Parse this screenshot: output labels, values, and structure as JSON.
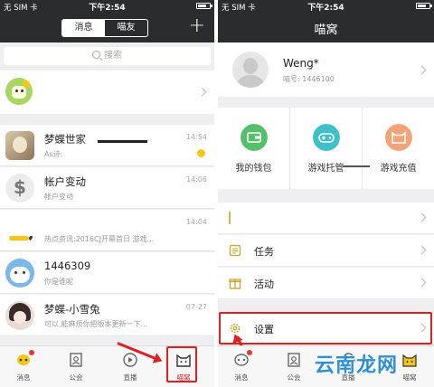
{
  "left": {
    "status": {
      "carrier": "无 SIM 卡",
      "time": "下午2:54"
    },
    "tabs": {
      "messages": "消息",
      "friends": "喵友"
    },
    "plus": "+",
    "search": {
      "placeholder": "搜索"
    },
    "conversations": [
      {
        "name": "梦蝶世家",
        "subtitle": "As诗:",
        "time": "14:54"
      },
      {
        "name": "帐户变动",
        "subtitle": "帐户变动",
        "time": "14:06"
      },
      {
        "name": "",
        "subtitle": "热点资讯:2016CJ开幕首日 游戏...",
        "time": "14:04"
      },
      {
        "name": "1446309",
        "subtitle": "你是谁呢",
        "time": ""
      },
      {
        "name": "梦蝶-小雪兔",
        "subtitle": "可以,能麻烦你把版本更新一下...",
        "time": "07-27"
      }
    ],
    "tabbar": {
      "messages": "消息",
      "guild": "公会",
      "live": "直播",
      "nest": "喵窝"
    }
  },
  "right": {
    "status": {
      "carrier": "无 SIM 卡",
      "time": "下午2:54"
    },
    "title": "喵窝",
    "profile": {
      "name": "Weng*",
      "id": "喵号: 1446100"
    },
    "grid": {
      "wallet": "我的钱包",
      "game_helper": "游戏托管",
      "game_recharge": "游戏充值"
    },
    "rows": {
      "first": "",
      "tasks": "任务",
      "events": "活动",
      "settings": "设置"
    },
    "tabbar": {
      "messages": "消息",
      "guild": "公会",
      "live": "直播",
      "nest": "喵窝"
    }
  },
  "watermark": "云南龙网",
  "colors": {
    "topbar": "#2b2c30",
    "highlight": "#e02020",
    "accent_yellow": "#f5c518",
    "wallet_green": "#55c06a",
    "game_teal": "#3fc0c6",
    "recharge_orange": "#f3a37a"
  }
}
